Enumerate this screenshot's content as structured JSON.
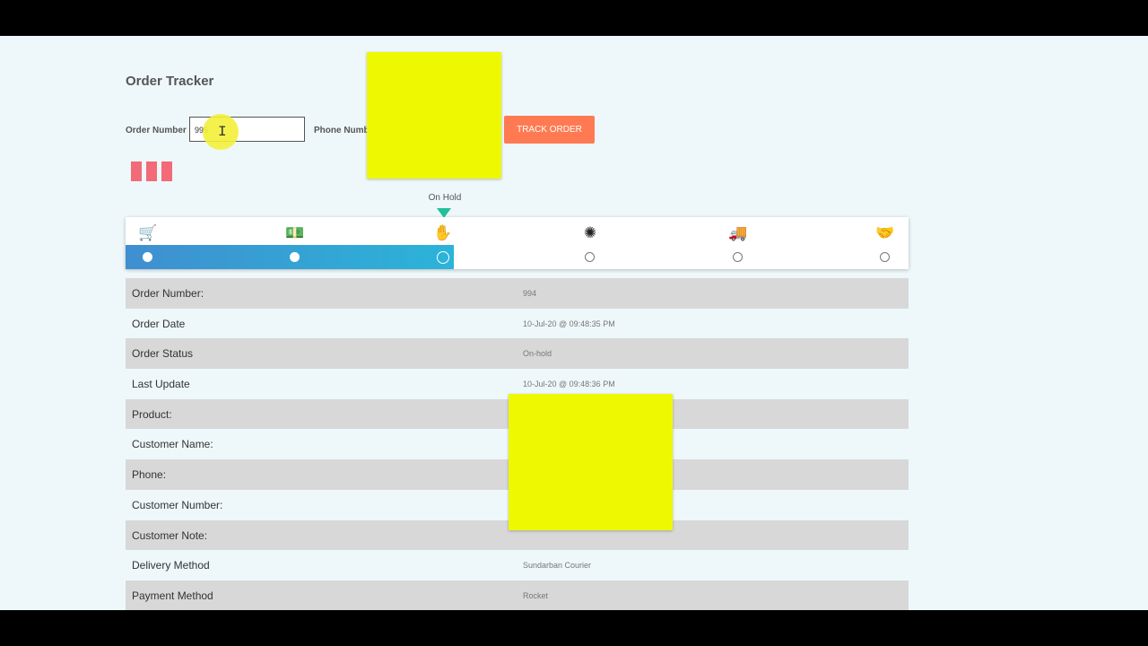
{
  "page_title": "Order Tracker",
  "form": {
    "order_label": "Order Number",
    "order_value": "995",
    "phone_label": "Phone Number",
    "track_label": "TRACK ORDER"
  },
  "status_label": "On Hold",
  "stages": [
    {
      "icon": "cart-icon",
      "glyph": "🛒",
      "state": "done"
    },
    {
      "icon": "cash-icon",
      "glyph": "💵",
      "state": "done"
    },
    {
      "icon": "hand-icon",
      "glyph": "✋",
      "state": "active"
    },
    {
      "icon": "spinner-icon",
      "glyph": "✺",
      "state": "pending"
    },
    {
      "icon": "truck-icon",
      "glyph": "🚚",
      "state": "pending"
    },
    {
      "icon": "handshake-icon",
      "glyph": "🤝",
      "state": "pending"
    }
  ],
  "details": [
    {
      "key": "Order Number:",
      "value": "994"
    },
    {
      "key": "Order Date",
      "value": "10-Jul-20 @ 09:48:35 PM"
    },
    {
      "key": "Order Status",
      "value": "On-hold"
    },
    {
      "key": "Last Update",
      "value": "10-Jul-20 @ 09:48:36 PM"
    },
    {
      "key": "Product:",
      "value": ""
    },
    {
      "key": "Customer Name:",
      "value": ""
    },
    {
      "key": "Phone:",
      "value": ""
    },
    {
      "key": "Customer Number:",
      "value": ""
    },
    {
      "key": "Customer Note:",
      "value": ""
    },
    {
      "key": "Delivery Method",
      "value": "Sundarban Courier"
    },
    {
      "key": "Payment Method",
      "value": "Rocket"
    }
  ],
  "colors": {
    "accent": "#ff7a52",
    "progress": "#2bb4d8",
    "pointer": "#22c09a",
    "highlight": "#eef800"
  }
}
